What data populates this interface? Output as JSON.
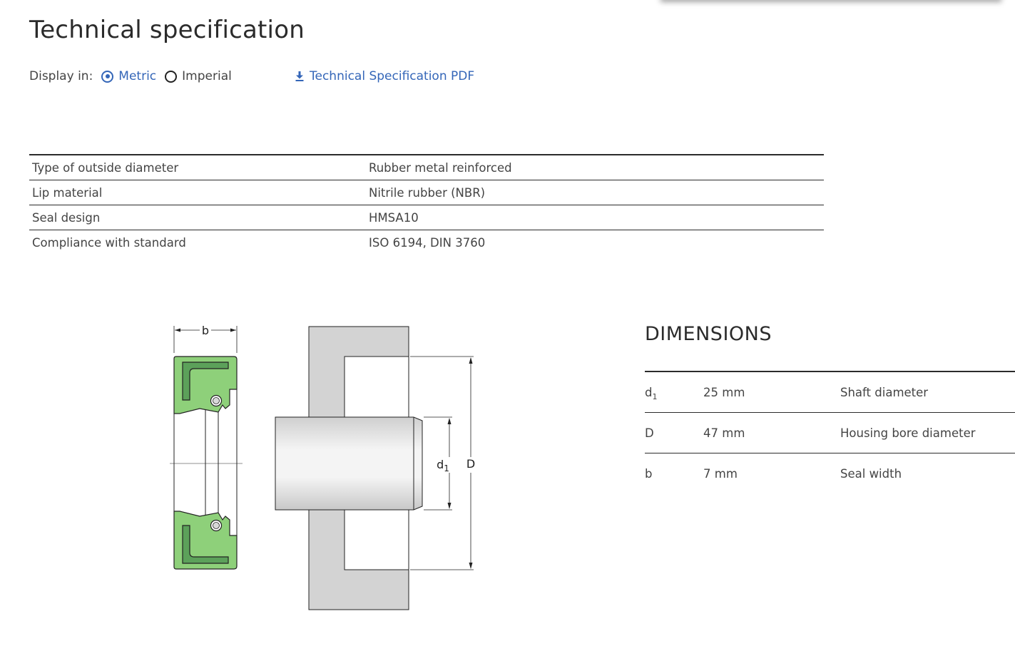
{
  "page_title": "Technical specification",
  "display": {
    "label": "Display in:",
    "options": [
      {
        "label": "Metric",
        "selected": true
      },
      {
        "label": "Imperial",
        "selected": false
      }
    ]
  },
  "pdf_link": {
    "label": "Technical Specification PDF",
    "icon": "download-icon"
  },
  "spec_rows": [
    {
      "key": "Type of outside diameter",
      "value": "Rubber metal reinforced"
    },
    {
      "key": "Lip material",
      "value": "Nitrile rubber (NBR)"
    },
    {
      "key": "Seal design",
      "value": "HMSA10"
    },
    {
      "key": "Compliance with standard",
      "value": "ISO 6194, DIN 3760"
    }
  ],
  "diagram": {
    "labels": {
      "b": "b",
      "d": "d",
      "d_sub": "1",
      "D": "D"
    },
    "colors": {
      "seal_green": "#8ed07a",
      "seal_dark_green": "#5ca15a",
      "housing_gray": "#d3d3d3"
    }
  },
  "dimensions": {
    "title": "DIMENSIONS",
    "rows": [
      {
        "symbol": "d",
        "symbol_sub": "1",
        "value": "25 mm",
        "description": "Shaft diameter"
      },
      {
        "symbol": "D",
        "symbol_sub": "",
        "value": "47 mm",
        "description": "Housing bore diameter"
      },
      {
        "symbol": "b",
        "symbol_sub": "",
        "value": "7 mm",
        "description": "Seal width"
      }
    ]
  },
  "colors": {
    "accent": "#3466b8",
    "text": "#444444",
    "rule": "#2b2b2b"
  }
}
